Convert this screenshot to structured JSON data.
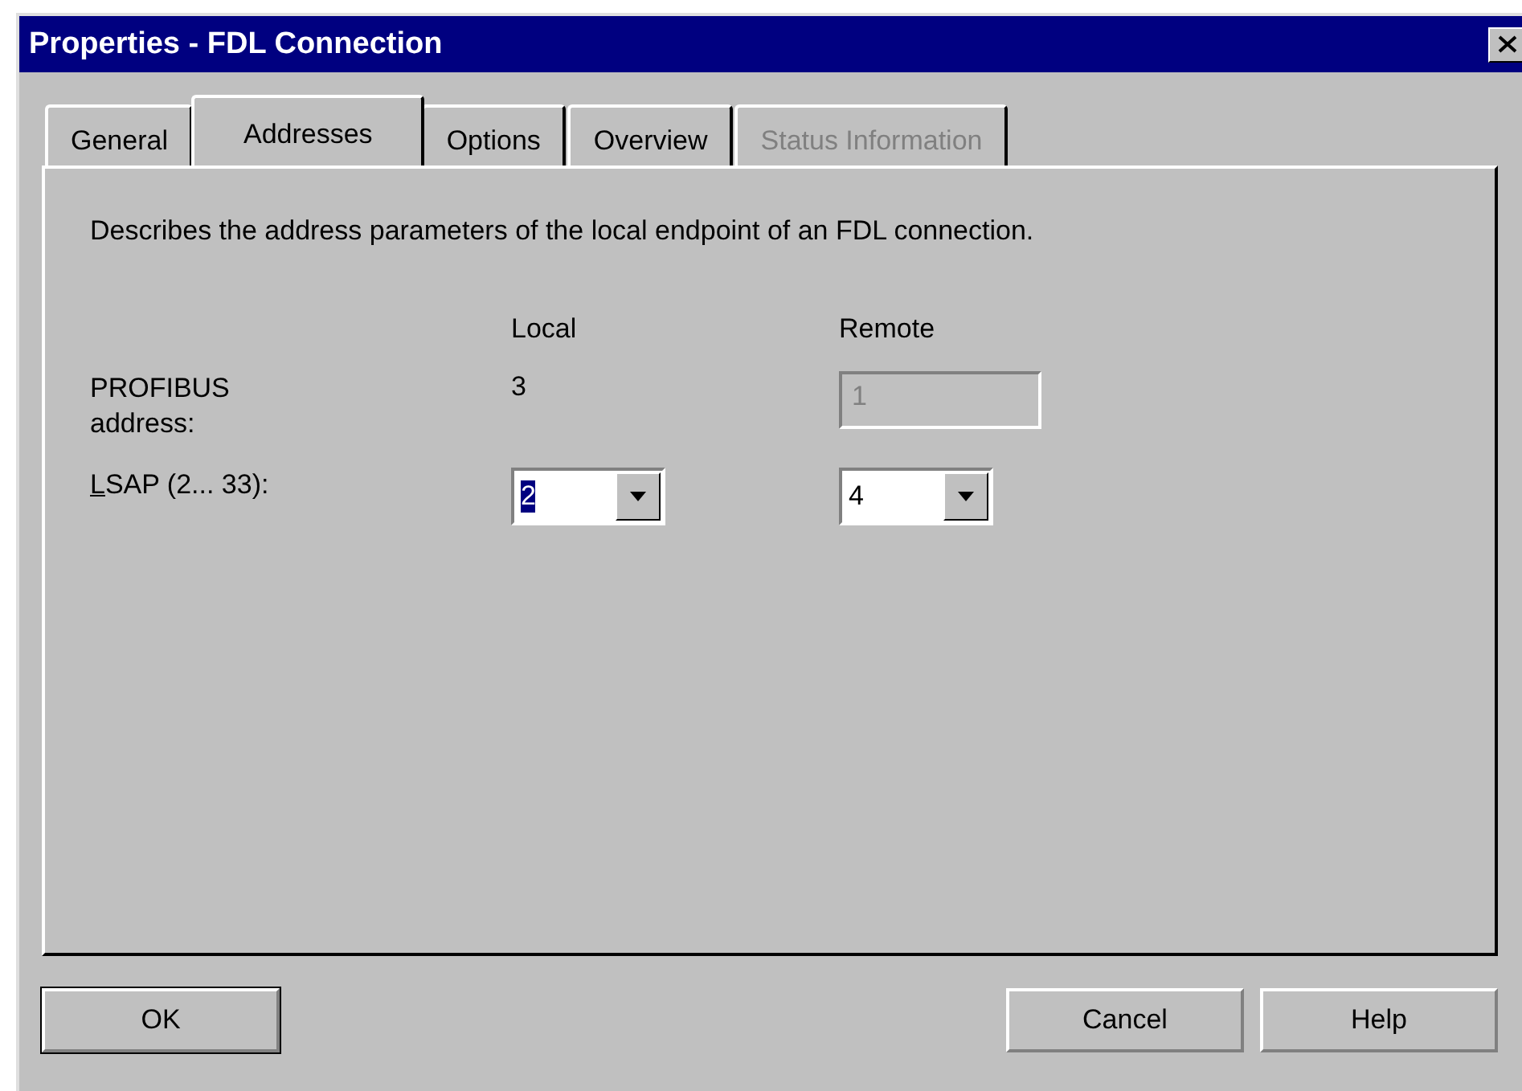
{
  "window": {
    "title": "Properties - FDL Connection"
  },
  "tabs": [
    {
      "label": "General",
      "selected": false,
      "disabled": false
    },
    {
      "label": "Addresses",
      "selected": true,
      "disabled": false
    },
    {
      "label": "Options",
      "selected": false,
      "disabled": false
    },
    {
      "label": "Overview",
      "selected": false,
      "disabled": false
    },
    {
      "label": "Status Information",
      "selected": false,
      "disabled": true
    }
  ],
  "description": "Describes the address parameters of the local endpoint of an FDL connection.",
  "columns": [
    "Local",
    "Remote"
  ],
  "rows": [
    {
      "label": "PROFIBUS address:",
      "first_letter_underlined": false,
      "local": {
        "kind": "text",
        "value": "3"
      },
      "remote": {
        "kind": "field",
        "value": "1",
        "disabled": true
      }
    },
    {
      "label": "LSAP (2... 33):",
      "first_letter_underlined": true,
      "local": {
        "kind": "combo",
        "value": "2",
        "highlighted": true
      },
      "remote": {
        "kind": "combo",
        "value": "4",
        "highlighted": false
      }
    }
  ],
  "buttons": [
    {
      "label": "OK",
      "default": true
    },
    {
      "label": "Cancel",
      "default": false
    },
    {
      "label": "Help",
      "default": false
    }
  ]
}
